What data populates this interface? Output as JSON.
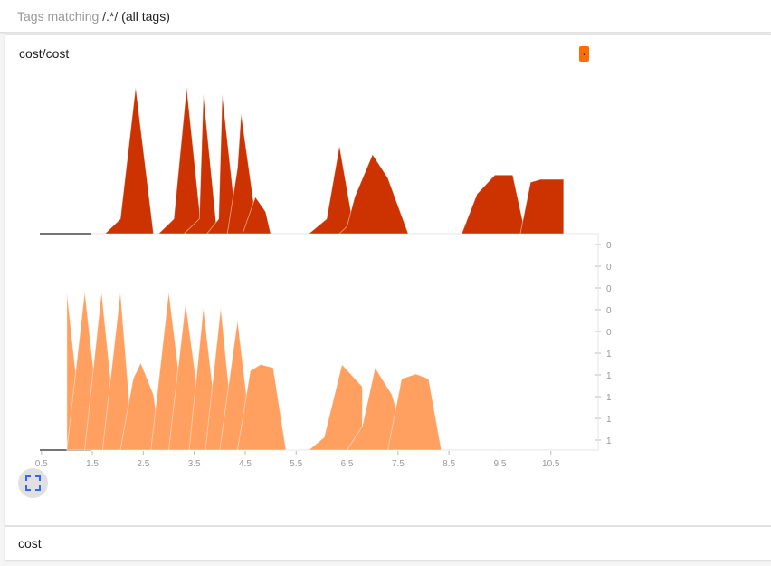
{
  "search": {
    "prefix": "Tags matching ",
    "regex": "/.*/",
    "suffix": " (all tags)"
  },
  "card": {
    "title": "cost/cost",
    "legend_toggle": ".",
    "expand_icon": "fullscreen-icon"
  },
  "section": {
    "title": "cost"
  },
  "colors": {
    "dark": "#cc3300",
    "light": "#ffa060",
    "accent": "#ff6d00"
  },
  "chart_data": {
    "type": "area",
    "panels": [
      {
        "name": "upper",
        "color": "#cc3300",
        "peaks": [
          {
            "x": [
              1.75,
              2.05,
              2.35,
              2.7
            ],
            "y": [
              0,
              0.1,
              1.0,
              0
            ]
          },
          {
            "x": [
              2.8,
              3.1,
              3.35,
              3.65
            ],
            "y": [
              0,
              0.1,
              1.0,
              0
            ]
          },
          {
            "x": [
              3.3,
              3.6,
              3.68,
              3.95
            ],
            "y": [
              0,
              0.1,
              0.95,
              0
            ]
          },
          {
            "x": [
              3.75,
              3.98,
              4.05,
              4.35
            ],
            "y": [
              0,
              0.1,
              0.95,
              0
            ]
          },
          {
            "x": [
              4.15,
              4.35,
              4.42,
              4.75
            ],
            "y": [
              0,
              0.45,
              0.82,
              0
            ]
          },
          {
            "x": [
              4.45,
              4.7,
              4.9,
              5.0
            ],
            "y": [
              0,
              0.25,
              0.15,
              0
            ]
          },
          {
            "x": [
              5.75,
              6.1,
              6.35,
              6.65
            ],
            "y": [
              0,
              0.1,
              0.6,
              0
            ]
          },
          {
            "x": [
              6.35,
              6.5,
              6.65,
              7.0,
              7.3,
              7.7
            ],
            "y": [
              0,
              0.05,
              0.25,
              0.54,
              0.38,
              0
            ]
          },
          {
            "x": [
              8.75,
              9.05,
              9.4,
              9.75,
              10.0
            ],
            "y": [
              0,
              0.27,
              0.4,
              0.4,
              0
            ]
          },
          {
            "x": [
              9.9,
              10.1,
              10.3,
              10.75
            ],
            "y": [
              0,
              0.35,
              0.37,
              0.37
            ]
          }
        ]
      },
      {
        "name": "lower",
        "color": "#ffa060",
        "peaks": [
          {
            "x": [
              1.0,
              1.0,
              1.15,
              1.35
            ],
            "y": [
              0,
              1.0,
              0.55,
              0
            ]
          },
          {
            "x": [
              1.0,
              1.35,
              1.7
            ],
            "y": [
              0,
              1.0,
              0
            ]
          },
          {
            "x": [
              1.35,
              1.68,
              2.0
            ],
            "y": [
              0,
              1.0,
              0
            ]
          },
          {
            "x": [
              1.7,
              2.05,
              2.3
            ],
            "y": [
              0,
              1.0,
              0
            ]
          },
          {
            "x": [
              2.05,
              2.3,
              2.45,
              2.7,
              2.85
            ],
            "y": [
              0,
              0.45,
              0.55,
              0.35,
              0
            ]
          },
          {
            "x": [
              2.65,
              3.0,
              3.38
            ],
            "y": [
              0,
              1.0,
              0
            ]
          },
          {
            "x": [
              3.0,
              3.33,
              3.72
            ],
            "y": [
              0,
              0.93,
              0
            ]
          },
          {
            "x": [
              3.4,
              3.68,
              4.0
            ],
            "y": [
              0,
              0.9,
              0
            ]
          },
          {
            "x": [
              3.72,
              4.02,
              4.3
            ],
            "y": [
              0,
              0.9,
              0
            ]
          },
          {
            "x": [
              4.0,
              4.35,
              4.65
            ],
            "y": [
              0,
              0.82,
              0
            ]
          },
          {
            "x": [
              4.35,
              4.6,
              4.8,
              5.05,
              5.3
            ],
            "y": [
              0,
              0.5,
              0.54,
              0.52,
              0
            ]
          },
          {
            "x": [
              5.75,
              6.05,
              6.4,
              6.8
            ],
            "y": [
              0,
              0.08,
              0.54,
              0.4
            ]
          },
          {
            "x": [
              6.5,
              6.8,
              7.05,
              7.38,
              7.7
            ],
            "y": [
              0,
              0.15,
              0.52,
              0.35,
              0
            ]
          },
          {
            "x": [
              7.3,
              7.57,
              7.85,
              8.1,
              8.35
            ],
            "y": [
              0,
              0.45,
              0.48,
              0.45,
              0
            ]
          }
        ]
      }
    ],
    "x_ticks": [
      "0.5",
      "1.5",
      "2.5",
      "3.5",
      "4.5",
      "5.5",
      "6.5",
      "7.5",
      "8.5",
      "9.5",
      "10.5"
    ],
    "y_ticks": [
      "0",
      "0",
      "0",
      "0",
      "0",
      "1",
      "1",
      "1",
      "1",
      "1"
    ],
    "xlim": [
      0.0,
      10.8
    ],
    "grid": false,
    "legend": "none"
  }
}
